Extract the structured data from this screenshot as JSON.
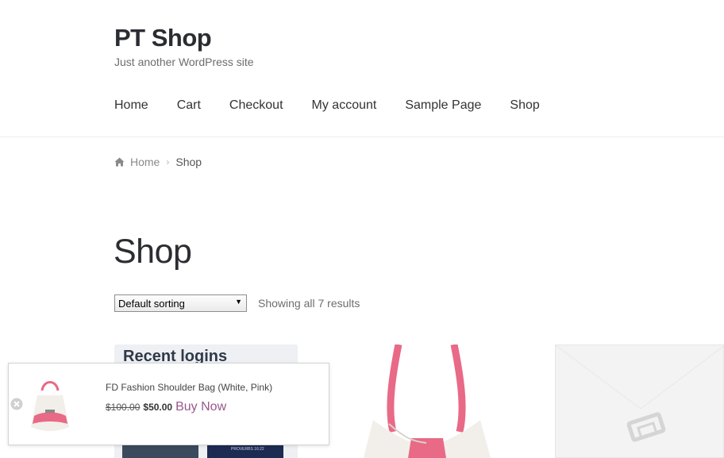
{
  "site": {
    "title": "PT Shop",
    "description": "Just another WordPress site"
  },
  "nav": {
    "items": [
      {
        "label": "Home"
      },
      {
        "label": "Cart"
      },
      {
        "label": "Checkout"
      },
      {
        "label": "My account"
      },
      {
        "label": "Sample Page"
      },
      {
        "label": "Shop"
      }
    ]
  },
  "breadcrumb": {
    "home_icon": "home-icon",
    "home_label": "Home",
    "current": "Shop"
  },
  "page": {
    "title": "Shop"
  },
  "shop": {
    "sorting_selected": "Default sorting",
    "result_count": "Showing all 7 results"
  },
  "widget": {
    "title": "Recent logins",
    "thumb_caption": "PROVERBS 16:22"
  },
  "popup": {
    "product_name": "FD Fashion Shoulder Bag (White, Pink)",
    "old_price": "$100.00",
    "new_price": "$50.00",
    "buy_label": "Buy Now",
    "close_icon": "close-circle-icon"
  },
  "colors": {
    "link_accent": "#96588a",
    "bag_pink": "#e86a86",
    "heading": "#2c2d33"
  }
}
